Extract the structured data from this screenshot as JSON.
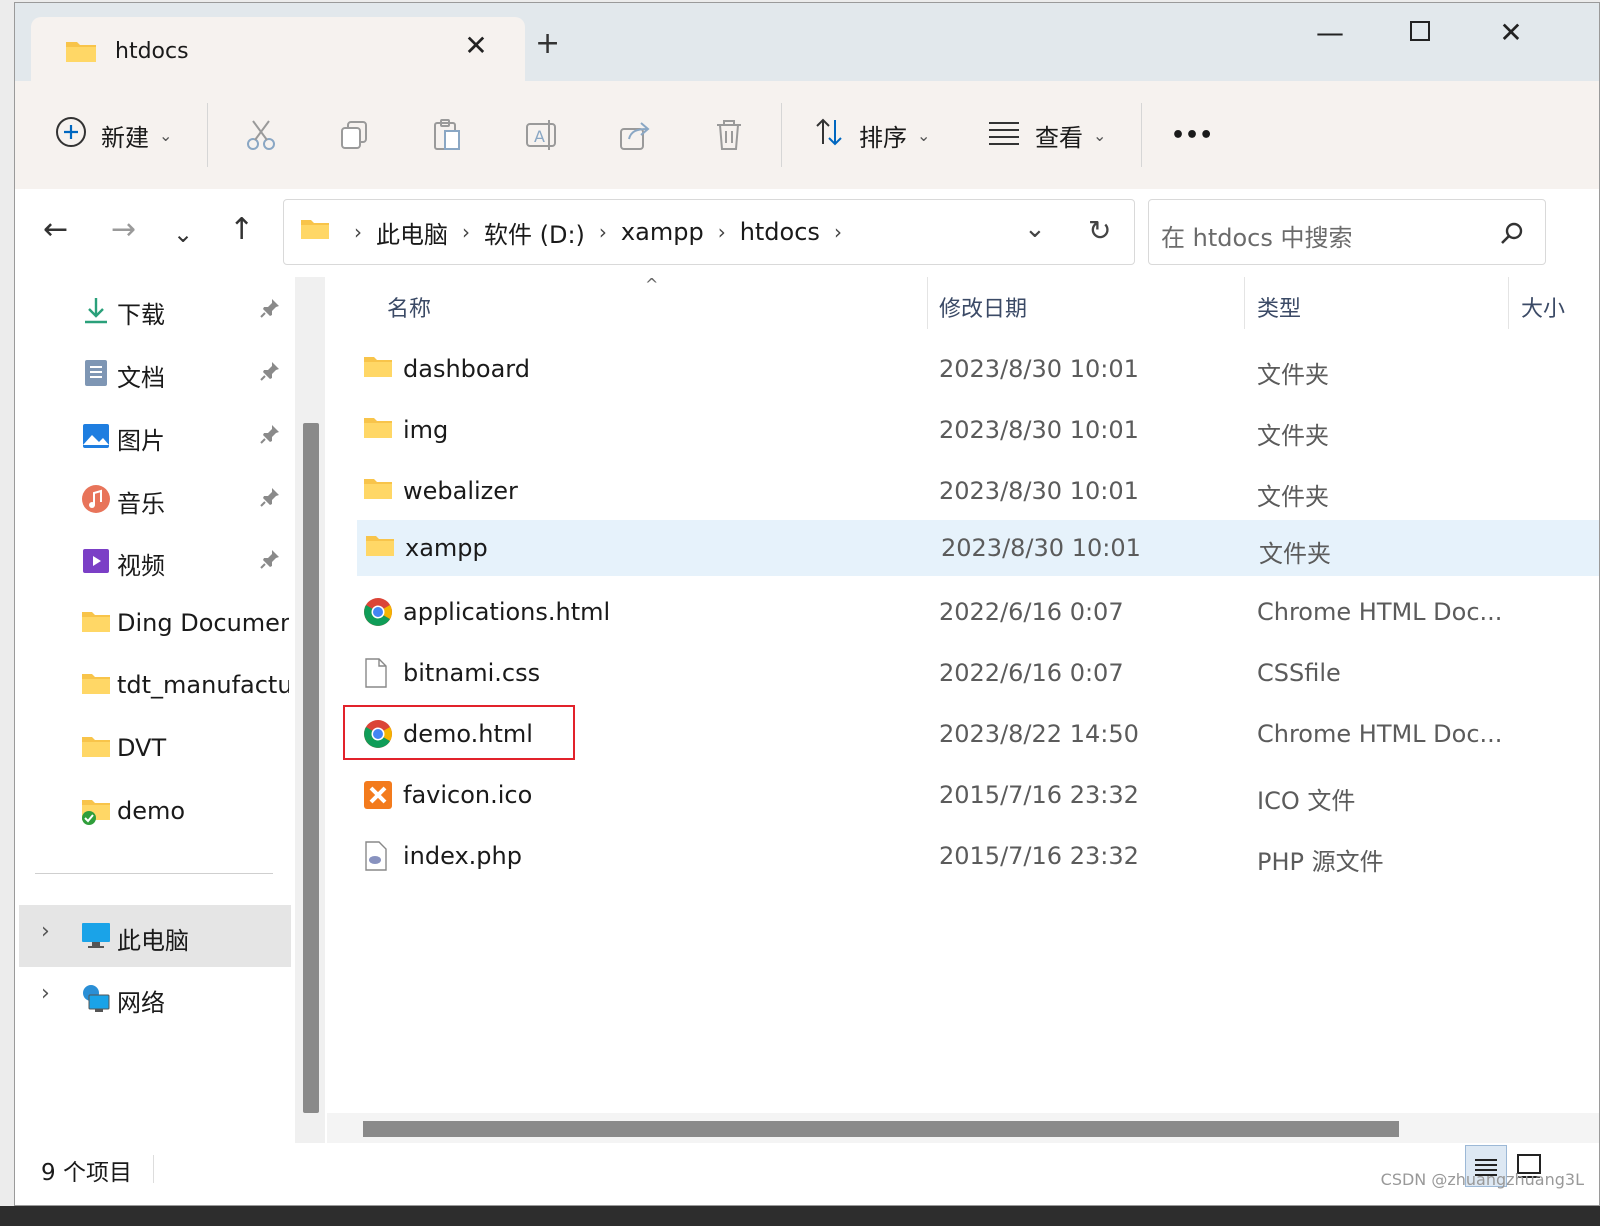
{
  "tab": {
    "title": "htdocs"
  },
  "toolbar": {
    "new_label": "新建",
    "sort_label": "排序",
    "view_label": "查看",
    "more_label": "•••"
  },
  "address": {
    "crumbs": [
      "此电脑",
      "软件 (D:)",
      "xampp",
      "htdocs"
    ]
  },
  "search": {
    "placeholder": "在 htdocs 中搜索"
  },
  "sidebar": {
    "quick": [
      {
        "label": "下载",
        "icon": "download-icon",
        "pinned": true
      },
      {
        "label": "文档",
        "icon": "document-icon",
        "pinned": true
      },
      {
        "label": "图片",
        "icon": "pictures-icon",
        "pinned": true
      },
      {
        "label": "音乐",
        "icon": "music-icon",
        "pinned": true
      },
      {
        "label": "视频",
        "icon": "video-icon",
        "pinned": true
      },
      {
        "label": "Ding Document",
        "icon": "folder-icon",
        "pinned": false
      },
      {
        "label": "tdt_manufacture",
        "icon": "folder-icon",
        "pinned": false
      },
      {
        "label": "DVT",
        "icon": "folder-icon",
        "pinned": false
      },
      {
        "label": "demo",
        "icon": "folder-synced-icon",
        "pinned": false
      }
    ],
    "tree": [
      {
        "label": "此电脑",
        "icon": "computer-icon"
      },
      {
        "label": "网络",
        "icon": "network-icon"
      }
    ]
  },
  "columns": {
    "name": "名称",
    "date": "修改日期",
    "type": "类型",
    "size": "大小"
  },
  "files": [
    {
      "name": "dashboard",
      "date": "2023/8/30 10:01",
      "type": "文件夹",
      "icon": "folder-icon"
    },
    {
      "name": "img",
      "date": "2023/8/30 10:01",
      "type": "文件夹",
      "icon": "folder-icon"
    },
    {
      "name": "webalizer",
      "date": "2023/8/30 10:01",
      "type": "文件夹",
      "icon": "folder-icon"
    },
    {
      "name": "xampp",
      "date": "2023/8/30 10:01",
      "type": "文件夹",
      "icon": "folder-icon"
    },
    {
      "name": "applications.html",
      "date": "2022/6/16 0:07",
      "type": "Chrome HTML Doc...",
      "icon": "chrome-icon"
    },
    {
      "name": "bitnami.css",
      "date": "2022/6/16 0:07",
      "type": "CSSfile",
      "icon": "file-icon"
    },
    {
      "name": "demo.html",
      "date": "2023/8/22 14:50",
      "type": "Chrome HTML Doc...",
      "icon": "chrome-icon"
    },
    {
      "name": "favicon.ico",
      "date": "2015/7/16 23:32",
      "type": "ICO 文件",
      "icon": "xampp-icon"
    },
    {
      "name": "index.php",
      "date": "2015/7/16 23:32",
      "type": "PHP 源文件",
      "icon": "php-file-icon"
    }
  ],
  "status": {
    "count": "9 个项目"
  },
  "watermark": "CSDN @zhuangzhuang3L",
  "colors": {
    "accent": "#0067c0",
    "folder": "#f8c44a",
    "highlight_red": "#e2222b"
  }
}
